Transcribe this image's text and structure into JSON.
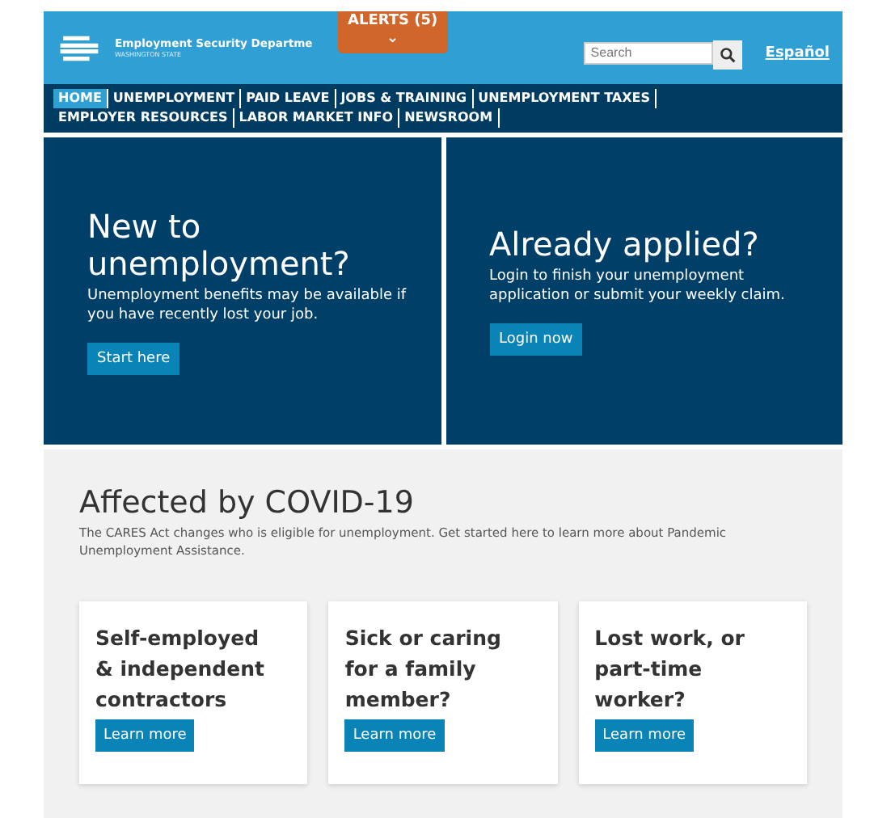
{
  "header": {
    "title": "Employment Security Departme",
    "subtitle": "WASHINGTON STATE",
    "alerts": {
      "label": "ALERTS (5)",
      "caret": "⌄"
    },
    "search": {
      "placeholder": "Search"
    },
    "language_link": "Español"
  },
  "nav": [
    {
      "label": "HOME",
      "selected": true
    },
    {
      "label": "UNEMPLOYMENT",
      "selected": false
    },
    {
      "label": "PAID LEAVE",
      "selected": false
    },
    {
      "label": "JOBS & TRAINING",
      "selected": false
    },
    {
      "label": "UNEMPLOYMENT TAXES",
      "selected": false
    },
    {
      "label": "EMPLOYER RESOURCES",
      "selected": false
    },
    {
      "label": "LABOR MARKET INFO",
      "selected": false
    },
    {
      "label": "NEWSROOM",
      "selected": false
    }
  ],
  "hero": [
    {
      "heading": "New to unemployment?",
      "text": "Unemployment benefits may be available if you have recently lost your job.",
      "button": "Start here"
    },
    {
      "heading": "Already applied?",
      "text": "Login to finish your unemployment application or submit your weekly claim.",
      "button": "Login now"
    }
  ],
  "covid": {
    "heading": "Affected by COVID-19",
    "text": "The CARES Act changes who is eligible for unemployment. Get started here to learn more about Pandemic Unemployment Assistance.",
    "cards": [
      {
        "title": "Self-employed & independent contractors",
        "button": "Learn more"
      },
      {
        "title": "Sick or caring for a family member?",
        "button": "Learn more"
      },
      {
        "title": "Lost work, or part-time worker?",
        "button": "Learn more"
      }
    ]
  }
}
